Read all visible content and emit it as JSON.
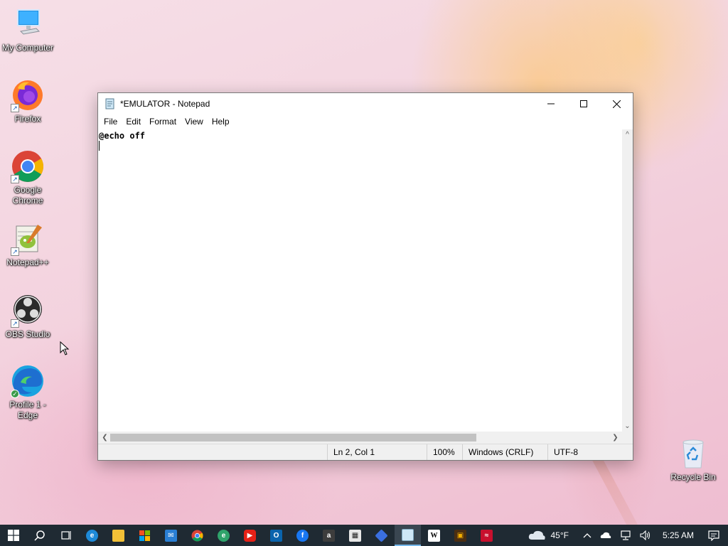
{
  "desktop": {
    "icons": [
      {
        "label": "My Computer"
      },
      {
        "label": "Firefox"
      },
      {
        "label": "Google Chrome"
      },
      {
        "label": "Notepad++"
      },
      {
        "label": "OBS Studio"
      },
      {
        "label": "Profile 1 - Edge"
      },
      {
        "label": "Recycle Bin"
      }
    ]
  },
  "notepad": {
    "title": "*EMULATOR - Notepad",
    "menu": [
      "File",
      "Edit",
      "Format",
      "View",
      "Help"
    ],
    "content_line1": "@echo off",
    "status": {
      "position": "Ln 2, Col 1",
      "zoom": "100%",
      "line_ending": "Windows (CRLF)",
      "encoding": "UTF-8"
    },
    "accent_color": "#0078d7"
  },
  "taskbar": {
    "pinned": [
      "start-icon",
      "search-icon",
      "task-view-icon",
      "edge-icon",
      "file-explorer-icon",
      "store-icon",
      "mail-icon",
      "chrome-icon",
      "edge-profile-icon",
      "youtube-icon",
      "outlook-icon",
      "facebook-icon",
      "amazon-icon",
      "ms-store-bag-icon",
      "photos-icon",
      "notepad-icon",
      "wikipedia-icon",
      "ups-icon",
      "red-app-icon"
    ],
    "weather": "45°F",
    "clock": "5:25 AM"
  }
}
